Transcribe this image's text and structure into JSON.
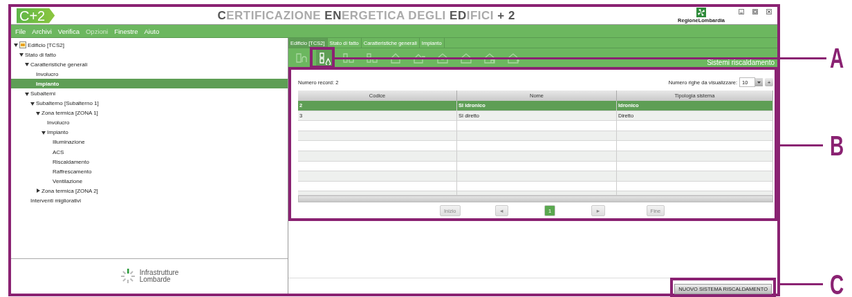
{
  "header": {
    "logo": "C+2",
    "title": "**C**ERTIFICAZIONE **EN**ERGETICA DEGLI **ED**IFICI **+ 2**",
    "region_logo": "RegioneLombardia"
  },
  "menu": [
    {
      "label": "File",
      "disabled": false
    },
    {
      "label": "Archivi",
      "disabled": false
    },
    {
      "label": "Verifica",
      "disabled": false
    },
    {
      "label": "Opzioni",
      "disabled": true
    },
    {
      "label": "Finestre",
      "disabled": false
    },
    {
      "label": "Aiuto",
      "disabled": false
    }
  ],
  "tree": [
    {
      "label": "Edificio [TCS2]",
      "expanded": true,
      "selected": false,
      "children": [
        {
          "label": "Stato di fatto",
          "expanded": true,
          "selected": false,
          "children": [
            {
              "label": "Caratteristiche generali",
              "expanded": true,
              "selected": false,
              "children": [
                {
                  "label": "Involucro",
                  "selected": false
                },
                {
                  "label": "Impianto",
                  "selected": true
                }
              ]
            },
            {
              "label": "Subalterni",
              "expanded": true,
              "selected": false,
              "children": [
                {
                  "label": "Subalterno [Subalterno 1]",
                  "expanded": true,
                  "selected": false,
                  "children": [
                    {
                      "label": "Zona termica [ZONA 1]",
                      "expanded": true,
                      "selected": false,
                      "children": [
                        {
                          "label": "Involucro",
                          "selected": false
                        },
                        {
                          "label": "Impianto",
                          "expanded": true,
                          "selected": false,
                          "children": [
                            {
                              "label": "Illuminazione",
                              "selected": false
                            },
                            {
                              "label": "ACS",
                              "selected": false
                            },
                            {
                              "label": "Riscaldamento",
                              "selected": false
                            },
                            {
                              "label": "Raffrescamento",
                              "selected": false
                            },
                            {
                              "label": "Ventilazione",
                              "selected": false
                            }
                          ]
                        }
                      ]
                    },
                    {
                      "label": "Zona termica [ZONA 2]",
                      "expanded": false,
                      "selected": false
                    }
                  ]
                }
              ]
            },
            {
              "label": "Interventi migliorativi",
              "selected": false
            }
          ]
        }
      ]
    }
  ],
  "sidebar_footer": {
    "logo_text": "Infrastrutture\nLombarde"
  },
  "breadcrumb": [
    {
      "label": "Edificio [TCS2]",
      "selected": true
    },
    {
      "label": "Stato di fatto",
      "selected": false
    },
    {
      "label": "Caratteristiche generali",
      "selected": false
    },
    {
      "label": "Impianto",
      "selected": false
    }
  ],
  "toolbar": {
    "title": "Sistemi riscaldamento",
    "tools": [
      {
        "selected": false
      },
      {
        "selected": true
      },
      {
        "selected": false
      },
      {
        "selected": false
      },
      {
        "selected": false
      },
      {
        "selected": false
      },
      {
        "selected": false
      },
      {
        "selected": false
      },
      {
        "selected": false
      },
      {
        "selected": false
      }
    ]
  },
  "table_panel": {
    "record_count": "Numero record: 2",
    "rows_label": "Numero righe da visualizzare:",
    "rows_per_page": "10",
    "add_button": "+",
    "columns": [
      "Codice",
      "Nome",
      "Tipologia sistema"
    ],
    "rows": [
      {
        "cells": [
          "2",
          "SI idronico",
          "Idronico"
        ],
        "selected": true
      },
      {
        "cells": [
          "3",
          "SI diretto",
          "Diretto"
        ],
        "selected": false
      }
    ],
    "pagination": [
      {
        "kind": "button",
        "label": "Inizio",
        "disabled": true
      },
      {
        "kind": "button",
        "label": "◄",
        "disabled": true
      },
      {
        "kind": "page",
        "label": "1",
        "selected": true
      },
      {
        "kind": "button",
        "label": "►",
        "disabled": true
      },
      {
        "kind": "button",
        "label": "Fine",
        "disabled": true
      }
    ]
  },
  "footer": {
    "button": "NUOVO SISTEMA RISCALDAMENTO"
  },
  "callouts": [
    {
      "letter": "A"
    },
    {
      "letter": "B"
    },
    {
      "letter": "C"
    }
  ]
}
